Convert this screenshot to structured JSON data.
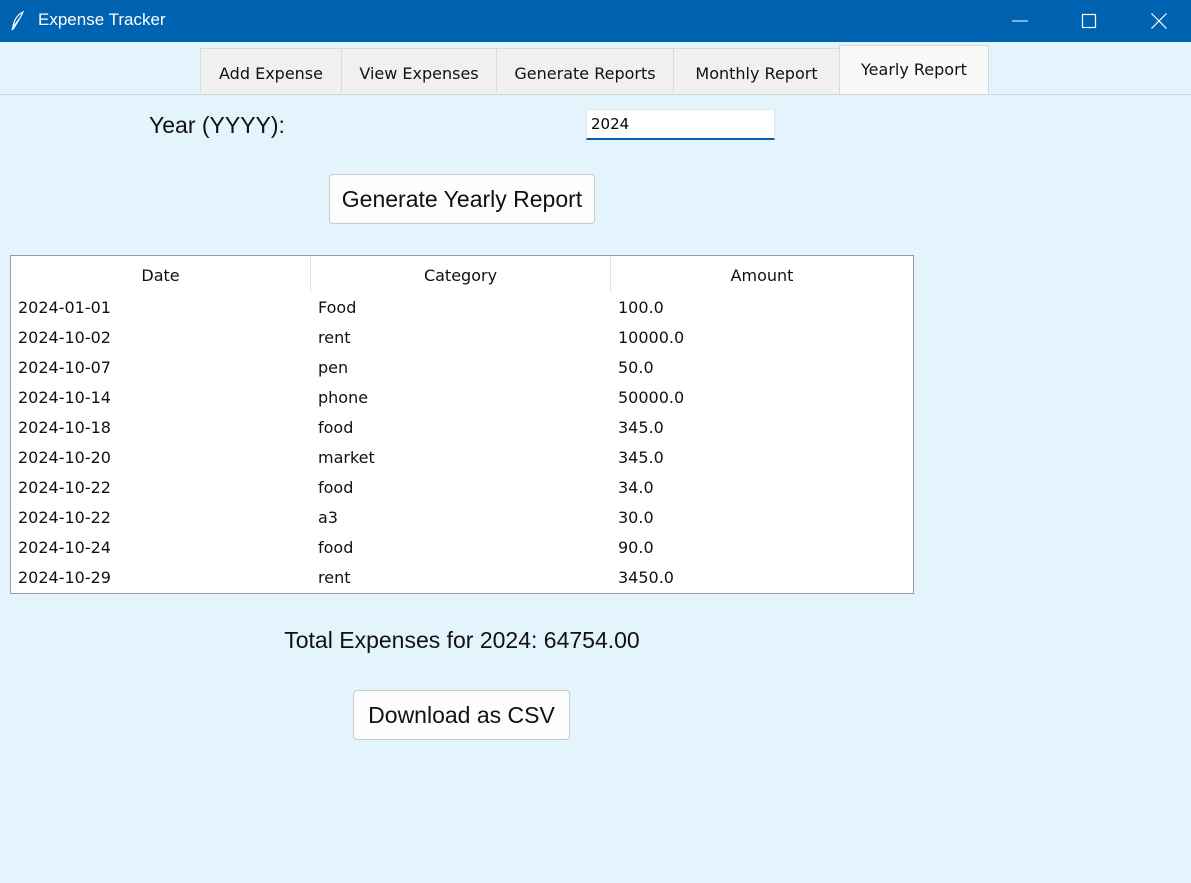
{
  "window": {
    "title": "Expense Tracker",
    "icons": {
      "app": "feather-icon",
      "minimize": "minimize-icon",
      "maximize": "maximize-icon",
      "close": "close-icon"
    },
    "titlebar_color": "#0063b1"
  },
  "tabs": [
    {
      "label": "Add Expense",
      "active": false
    },
    {
      "label": "View Expenses",
      "active": false
    },
    {
      "label": "Generate Reports",
      "active": false
    },
    {
      "label": "Monthly Report",
      "active": false
    },
    {
      "label": "Yearly Report",
      "active": true
    }
  ],
  "form": {
    "year_label": "Year (YYYY):",
    "year_value": "2024",
    "generate_button": "Generate Yearly Report"
  },
  "table": {
    "columns": [
      "Date",
      "Category",
      "Amount"
    ],
    "rows": [
      [
        "2024-01-01",
        "Food",
        "100.0"
      ],
      [
        "2024-10-02",
        "rent",
        "10000.0"
      ],
      [
        "2024-10-07",
        "pen",
        "50.0"
      ],
      [
        "2024-10-14",
        "phone",
        "50000.0"
      ],
      [
        "2024-10-18",
        "food",
        "345.0"
      ],
      [
        "2024-10-20",
        "market",
        "345.0"
      ],
      [
        "2024-10-22",
        "food",
        "34.0"
      ],
      [
        "2024-10-22",
        "a3",
        "30.0"
      ],
      [
        "2024-10-24",
        "food",
        "90.0"
      ],
      [
        "2024-10-29",
        "rent",
        "3450.0"
      ]
    ]
  },
  "summary": {
    "total_text": "Total Expenses for 2024: 64754.00"
  },
  "actions": {
    "download_button": "Download as CSV"
  }
}
